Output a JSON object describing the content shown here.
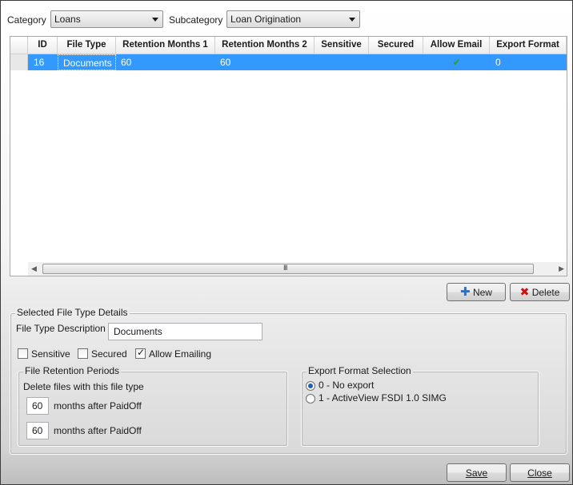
{
  "filters": {
    "category_label": "Category",
    "category_value": "Loans",
    "subcategory_label": "Subcategory",
    "subcategory_value": "Loan Origination"
  },
  "grid": {
    "columns": [
      "ID",
      "File Type",
      "Retention Months 1",
      "Retention Months 2",
      "Sensitive",
      "Secured",
      "Allow Email",
      "Export Format"
    ],
    "rows": [
      {
        "id": "16",
        "file_type": "Documents",
        "retention1": "60",
        "retention2": "60",
        "sensitive": "",
        "secured": "",
        "allow_email": "✔",
        "export_format": "0"
      }
    ],
    "scroll_grip": "III"
  },
  "toolbar": {
    "new_label": "New",
    "delete_label": "Delete",
    "new_icon": "plus-icon",
    "delete_icon": "x-icon"
  },
  "details": {
    "group_title": "Selected File Type Details",
    "description_label": "File Type Description",
    "description_value": "Documents",
    "sensitive_label": "Sensitive",
    "secured_label": "Secured",
    "allow_emailing_label": "Allow Emailing",
    "sensitive_checked": false,
    "secured_checked": false,
    "allow_emailing_checked": true,
    "retention": {
      "title": "File Retention Periods",
      "intro": "Delete files with this file type",
      "months1": "60",
      "months2": "60",
      "after_label1": "months after PaidOff",
      "after_label2": "months after PaidOff"
    },
    "export": {
      "title": "Export Format Selection",
      "option0": "0 - No export",
      "option1": "1 - ActiveView FSDI 1.0 SIMG",
      "selected": 0
    }
  },
  "footer": {
    "save_label": "Save",
    "close_label": "Close"
  },
  "colors": {
    "selection": "#3399ff",
    "check_green": "#2e9e2e",
    "delete_red": "#cc1111",
    "plus_blue": "#2b6cc4"
  }
}
